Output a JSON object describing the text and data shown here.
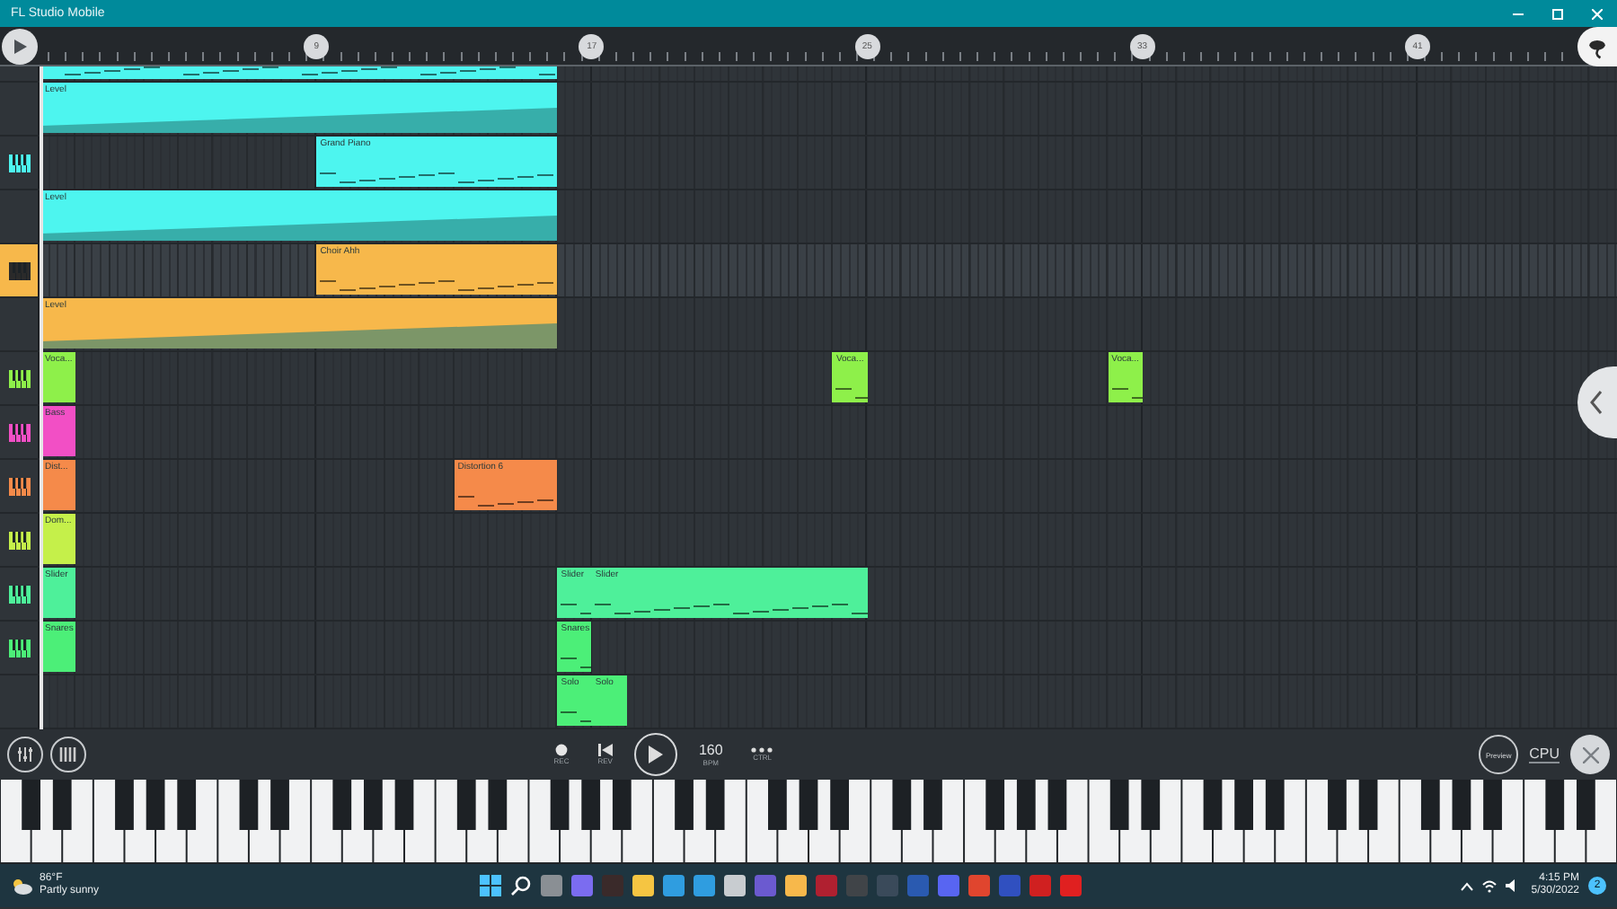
{
  "window": {
    "title": "FL Studio Mobile"
  },
  "ruler": {
    "markers": [
      "9",
      "17",
      "25",
      "33",
      "41"
    ]
  },
  "tracks": [
    {
      "kind": "plain",
      "selected": false,
      "color": "#4df5ef",
      "clips": [
        {
          "kind": "notes"
        }
      ]
    },
    {
      "kind": "plain",
      "selected": false,
      "color": "#4df5ef",
      "clips": [
        {
          "kind": "automation",
          "label": "Level"
        }
      ]
    },
    {
      "kind": "instrument",
      "selected": false,
      "color": "#4df5ef",
      "clips": [
        {
          "kind": "notes",
          "label": "Grand Piano"
        }
      ]
    },
    {
      "kind": "plain",
      "selected": false,
      "color": "#4df5ef",
      "clips": [
        {
          "kind": "automation",
          "label": "Level"
        }
      ]
    },
    {
      "kind": "instrument",
      "selected": true,
      "color": "#f7b84b",
      "clips": [
        {
          "kind": "notes",
          "label": "Choir Ahh"
        }
      ]
    },
    {
      "kind": "plain",
      "selected": false,
      "color": "#f7b84b",
      "clips": [
        {
          "kind": "automation",
          "label": "Level"
        }
      ]
    },
    {
      "kind": "instrument",
      "selected": false,
      "color": "#8ef04a",
      "clips": [
        {
          "kind": "empty",
          "label": "Voca..."
        },
        {
          "kind": "notes",
          "label": "Voca..."
        },
        {
          "kind": "notes",
          "label": "Voca..."
        }
      ]
    },
    {
      "kind": "instrument",
      "selected": false,
      "color": "#f24fc5",
      "clips": [
        {
          "kind": "empty",
          "label": "Bass"
        }
      ]
    },
    {
      "kind": "instrument",
      "selected": false,
      "color": "#f58a4a",
      "clips": [
        {
          "kind": "empty",
          "label": "Dist..."
        },
        {
          "kind": "notes",
          "label": "Distortion 6"
        }
      ]
    },
    {
      "kind": "instrument",
      "selected": false,
      "color": "#c5f04a",
      "clips": [
        {
          "kind": "empty",
          "label": "Dom..."
        }
      ]
    },
    {
      "kind": "instrument",
      "selected": false,
      "color": "#4ef09a",
      "clips": [
        {
          "kind": "empty",
          "label": "Slider"
        },
        {
          "kind": "notes",
          "label": "Slider"
        },
        {
          "kind": "notes",
          "label": "Slider"
        }
      ]
    },
    {
      "kind": "instrument",
      "selected": false,
      "color": "#4cef78",
      "clips": [
        {
          "kind": "empty",
          "label": "Snares"
        },
        {
          "kind": "notes",
          "label": "Snares"
        }
      ]
    },
    {
      "kind": "plain",
      "selected": false,
      "color": "#4cef78",
      "clips": [
        {
          "kind": "notes",
          "label": "Solo"
        },
        {
          "kind": "empty",
          "label": "Solo"
        }
      ]
    }
  ],
  "transport": {
    "rec": "REC",
    "rev": "REV",
    "tempo": "160",
    "tempo_label": "BPM",
    "ctrl": "CTRL",
    "preview": "Preview",
    "cpu": "CPU"
  },
  "taskbar": {
    "temperature": "86°F",
    "weather": "Partly sunny",
    "time": "4:15 PM",
    "date": "5/30/2022",
    "notifications": "2"
  }
}
